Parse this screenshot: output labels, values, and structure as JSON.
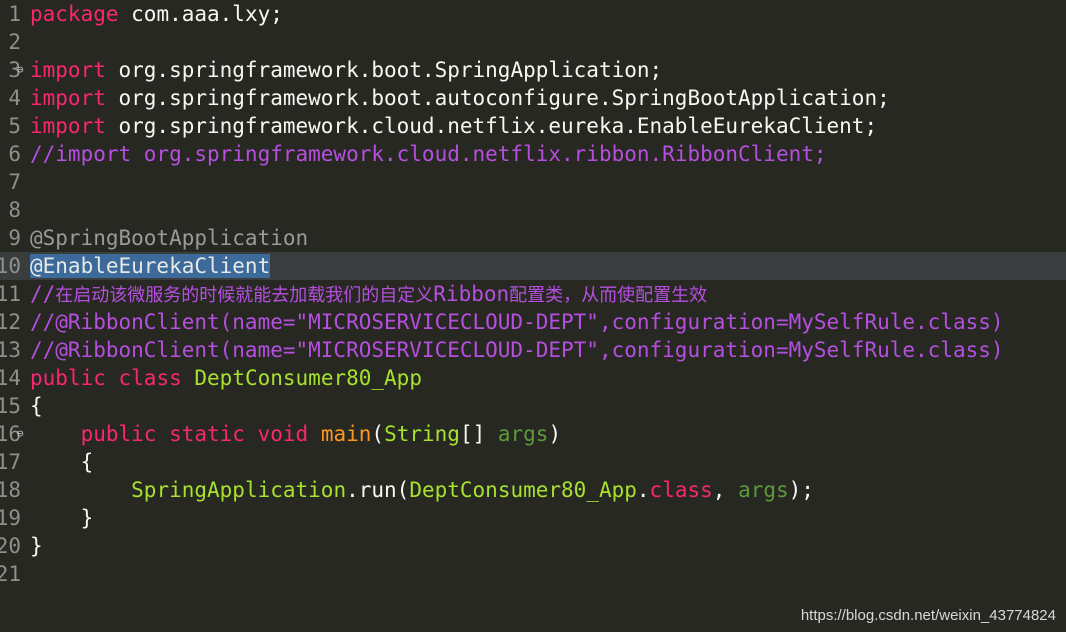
{
  "editor": {
    "lines": [
      {
        "num": "1",
        "fold": "",
        "current": false,
        "tokens": [
          {
            "text": "package",
            "cls": "t-kw"
          },
          {
            "text": " com.aaa.lxy;",
            "cls": "t-default"
          }
        ]
      },
      {
        "num": "2",
        "fold": "",
        "current": false,
        "tokens": []
      },
      {
        "num": "3",
        "fold": "⊖",
        "current": false,
        "tokens": [
          {
            "text": "import",
            "cls": "t-kw"
          },
          {
            "text": " org.springframework.boot.SpringApplication;",
            "cls": "t-default"
          }
        ]
      },
      {
        "num": "4",
        "fold": "",
        "current": false,
        "tokens": [
          {
            "text": "import",
            "cls": "t-kw"
          },
          {
            "text": " org.springframework.boot.autoconfigure.SpringBootApplication;",
            "cls": "t-default"
          }
        ]
      },
      {
        "num": "5",
        "fold": "",
        "current": false,
        "tokens": [
          {
            "text": "import",
            "cls": "t-kw"
          },
          {
            "text": " org.springframework.cloud.netflix.eureka.EnableEurekaClient;",
            "cls": "t-default"
          }
        ]
      },
      {
        "num": "6",
        "fold": "",
        "current": false,
        "tokens": [
          {
            "text": "//import org.springframework.cloud.netflix.ribbon.RibbonClient;",
            "cls": "t-comment"
          }
        ]
      },
      {
        "num": "7",
        "fold": "",
        "current": false,
        "tokens": []
      },
      {
        "num": "8",
        "fold": "",
        "current": false,
        "tokens": []
      },
      {
        "num": "9",
        "fold": "",
        "current": false,
        "tokens": [
          {
            "text": "@SpringBootApplication",
            "cls": "t-grey"
          }
        ]
      },
      {
        "num": "10",
        "fold": "",
        "current": true,
        "tokens": [
          {
            "text": "@EnableEurekaClient",
            "cls": "t-sel"
          }
        ]
      },
      {
        "num": "11",
        "fold": "",
        "current": false,
        "tokens": [
          {
            "text": "//",
            "cls": "t-comment"
          },
          {
            "text": "在启动该微服务的时候就能去加载我们的自定义",
            "cls": "t-comment cn"
          },
          {
            "text": "Ribbon",
            "cls": "t-comment"
          },
          {
            "text": "配置类，从而使配置生效",
            "cls": "t-comment cn"
          }
        ]
      },
      {
        "num": "12",
        "fold": "",
        "current": false,
        "tokens": [
          {
            "text": "//@RibbonClient(name=\"MICROSERVICECLOUD-DEPT\",configuration=MySelfRule.class)",
            "cls": "t-comment"
          }
        ]
      },
      {
        "num": "13",
        "fold": "",
        "current": false,
        "tokens": [
          {
            "text": "//@RibbonClient(name=\"MICROSERVICECLOUD-DEPT\",configuration=MySelfRule.class)",
            "cls": "t-comment"
          }
        ]
      },
      {
        "num": "14",
        "fold": "",
        "current": false,
        "tokens": [
          {
            "text": "public",
            "cls": "t-kw"
          },
          {
            "text": " ",
            "cls": "t-default"
          },
          {
            "text": "class",
            "cls": "t-kw"
          },
          {
            "text": " ",
            "cls": "t-default"
          },
          {
            "text": "DeptConsumer80_App",
            "cls": "t-green"
          }
        ]
      },
      {
        "num": "15",
        "fold": "",
        "current": false,
        "tokens": [
          {
            "text": "{",
            "cls": "t-default"
          }
        ]
      },
      {
        "num": "16",
        "fold": "⊖",
        "current": false,
        "tokens": [
          {
            "text": "    ",
            "cls": "t-default"
          },
          {
            "text": "public",
            "cls": "t-kw"
          },
          {
            "text": " ",
            "cls": "t-default"
          },
          {
            "text": "static",
            "cls": "t-kw"
          },
          {
            "text": " ",
            "cls": "t-default"
          },
          {
            "text": "void",
            "cls": "t-kw"
          },
          {
            "text": " ",
            "cls": "t-default"
          },
          {
            "text": "main",
            "cls": "t-orange"
          },
          {
            "text": "(",
            "cls": "t-default"
          },
          {
            "text": "String",
            "cls": "t-green"
          },
          {
            "text": "[] ",
            "cls": "t-default"
          },
          {
            "text": "args",
            "cls": "t-param"
          },
          {
            "text": ")",
            "cls": "t-default"
          }
        ]
      },
      {
        "num": "17",
        "fold": "",
        "current": false,
        "tokens": [
          {
            "text": "    {",
            "cls": "t-default"
          }
        ]
      },
      {
        "num": "18",
        "fold": "",
        "current": false,
        "tokens": [
          {
            "text": "        ",
            "cls": "t-default"
          },
          {
            "text": "SpringApplication",
            "cls": "t-green"
          },
          {
            "text": ".run(",
            "cls": "t-default"
          },
          {
            "text": "DeptConsumer80_App",
            "cls": "t-green"
          },
          {
            "text": ".",
            "cls": "t-default"
          },
          {
            "text": "class",
            "cls": "t-kw"
          },
          {
            "text": ", ",
            "cls": "t-default"
          },
          {
            "text": "args",
            "cls": "t-param"
          },
          {
            "text": ");",
            "cls": "t-default"
          }
        ]
      },
      {
        "num": "19",
        "fold": "",
        "current": false,
        "tokens": [
          {
            "text": "    }",
            "cls": "t-default"
          }
        ]
      },
      {
        "num": "20",
        "fold": "",
        "current": false,
        "tokens": [
          {
            "text": "}",
            "cls": "t-default"
          }
        ]
      },
      {
        "num": "21",
        "fold": "",
        "current": false,
        "tokens": []
      }
    ]
  },
  "watermark": "https://blog.csdn.net/weixin_43774824",
  "colors": {
    "background": "#272822",
    "keyword": "#f92672",
    "type": "#a6e22e",
    "method": "#fd971f",
    "comment": "#b64fe0",
    "annotation": "#9a9a9a",
    "selection": "#3c6a9a"
  }
}
